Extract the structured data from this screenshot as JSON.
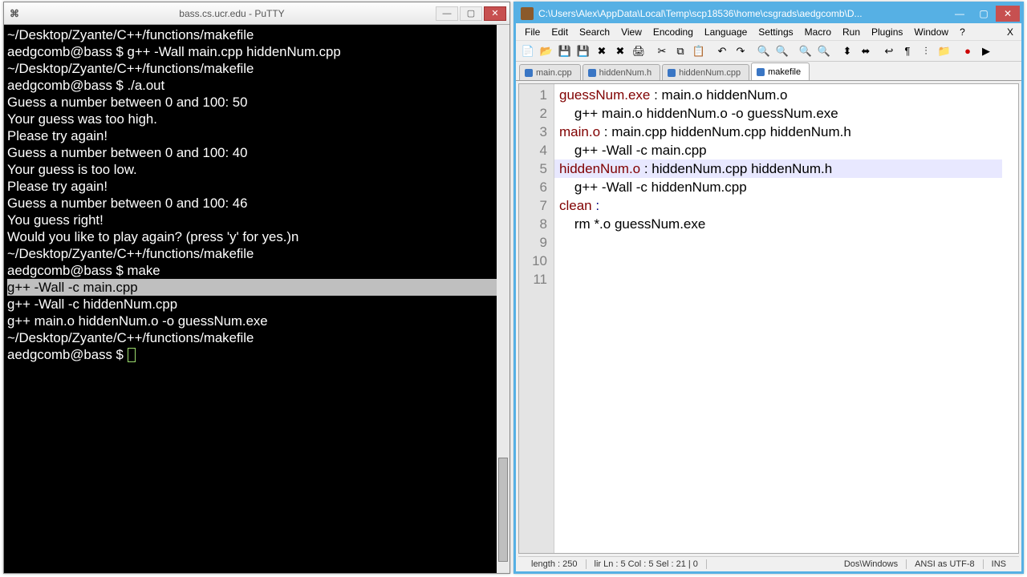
{
  "putty": {
    "title": "bass.cs.ucr.edu - PuTTY",
    "lines": [
      {
        "t": "~/Desktop/Zyante/C++/functions/makefile"
      },
      {
        "t": "aedgcomb@bass $ g++ -Wall main.cpp hiddenNum.cpp"
      },
      {
        "t": "~/Desktop/Zyante/C++/functions/makefile"
      },
      {
        "t": "aedgcomb@bass $ ./a.out"
      },
      {
        "t": "Guess a number between 0 and 100: 50"
      },
      {
        "t": "Your guess was too high."
      },
      {
        "t": "Please try again!"
      },
      {
        "t": "Guess a number between 0 and 100: 40"
      },
      {
        "t": "Your guess is too low."
      },
      {
        "t": "Please try again!"
      },
      {
        "t": "Guess a number between 0 and 100: 46"
      },
      {
        "t": "You guess right!"
      },
      {
        "t": "Would you like to play again? (press 'y' for yes.)n"
      },
      {
        "t": "~/Desktop/Zyante/C++/functions/makefile"
      },
      {
        "t": "aedgcomb@bass $ make"
      },
      {
        "t": "g++ -Wall -c main.cpp",
        "hl": true
      },
      {
        "t": "g++ -Wall -c hiddenNum.cpp"
      },
      {
        "t": "g++ main.o hiddenNum.o -o guessNum.exe"
      },
      {
        "t": "~/Desktop/Zyante/C++/functions/makefile"
      },
      {
        "t": "aedgcomb@bass $ ",
        "cursor": true
      }
    ]
  },
  "npp": {
    "title": "C:\\Users\\Alex\\AppData\\Local\\Temp\\scp18536\\home\\csgrads\\aedgcomb\\D...",
    "menu": [
      "File",
      "Edit",
      "Search",
      "View",
      "Encoding",
      "Language",
      "Settings",
      "Macro",
      "Run",
      "Plugins",
      "Window",
      "?"
    ],
    "tabs": [
      {
        "label": "main.cpp",
        "active": false
      },
      {
        "label": "hiddenNum.h",
        "active": false
      },
      {
        "label": "hiddenNum.cpp",
        "active": false
      },
      {
        "label": "makefile",
        "active": true
      }
    ],
    "code": [
      [
        {
          "c": "k-red",
          "t": "guessNum.exe"
        },
        {
          "c": "k-black",
          "t": " : main.o hiddenNum.o"
        }
      ],
      [
        {
          "c": "k-black",
          "t": "    g++ main.o hiddenNum.o -o guessNum.exe"
        }
      ],
      [
        {
          "c": "k-black",
          "t": ""
        }
      ],
      [
        {
          "c": "k-red",
          "t": "main.o"
        },
        {
          "c": "k-black",
          "t": " : main.cpp hiddenNum.cpp hiddenNum.h"
        }
      ],
      [
        {
          "c": "k-black",
          "t": "    g++ -Wall -c main.cpp"
        }
      ],
      [
        {
          "c": "k-black",
          "t": ""
        }
      ],
      [
        {
          "c": "k-red",
          "t": "hiddenNum.o"
        },
        {
          "c": "k-black",
          "t": " : hiddenNum.cpp hiddenNum.h"
        }
      ],
      [
        {
          "c": "k-black",
          "t": "    g++ -Wall -c hiddenNum.cpp"
        }
      ],
      [
        {
          "c": "k-black",
          "t": ""
        }
      ],
      [
        {
          "c": "k-red",
          "t": "clean"
        },
        {
          "c": "k-blue",
          "t": " :"
        }
      ],
      [
        {
          "c": "k-black",
          "t": "    rm *.o guessNum.exe"
        }
      ]
    ],
    "status": {
      "length": "length : 250",
      "pos": "lir  Ln : 5   Col : 5   Sel : 21 | 0",
      "eol": "Dos\\Windows",
      "enc": "ANSI as UTF-8",
      "ins": "INS"
    }
  },
  "win_btns": {
    "min": "—",
    "max": "▢",
    "close": "✕"
  }
}
